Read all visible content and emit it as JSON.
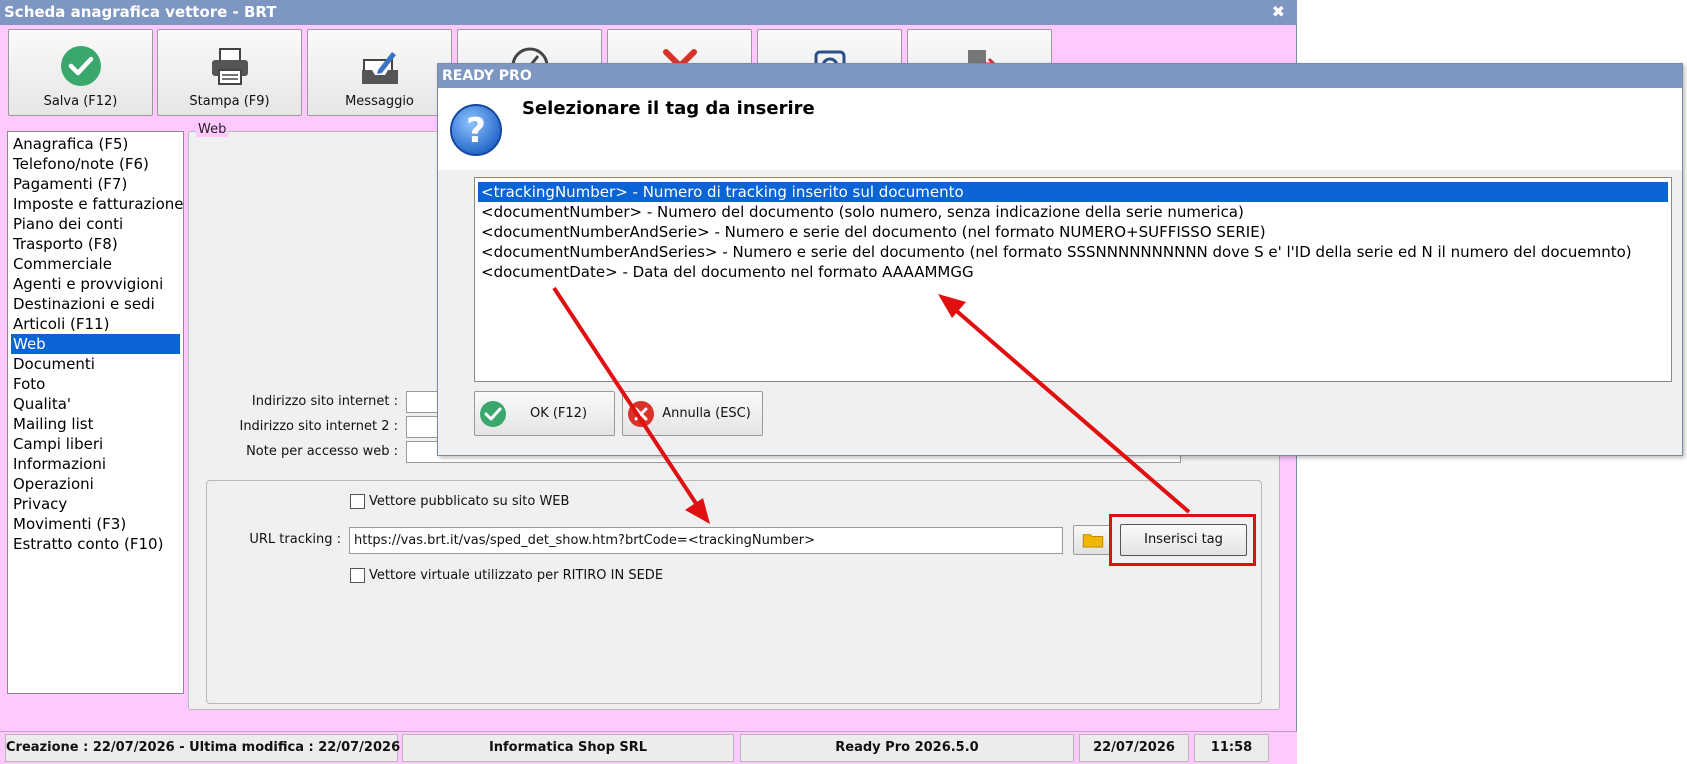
{
  "main_window": {
    "title": "Scheda anagrafica vettore - BRT",
    "close_glyph": "✖"
  },
  "toolbar": {
    "buttons": [
      {
        "label": "Salva (F12)",
        "icon": "check-circle-icon"
      },
      {
        "label": "Stampa (F9)",
        "icon": "printer-icon"
      },
      {
        "label": "Messaggio",
        "icon": "message-edit-icon"
      },
      {
        "label": "",
        "icon": "compass-icon"
      },
      {
        "label": "",
        "icon": "red-x-icon"
      },
      {
        "label": "",
        "icon": "camera-icon"
      },
      {
        "label": "",
        "icon": "exit-door-icon"
      }
    ]
  },
  "nav": {
    "items": [
      "Anagrafica (F5)",
      "Telefono/note (F6)",
      "Pagamenti (F7)",
      "Imposte e fatturazione",
      "Piano dei conti",
      "Trasporto (F8)",
      "Commerciale",
      "Agenti e provvigioni",
      "Destinazioni e sedi",
      "Articoli (F11)",
      "Web",
      "Documenti",
      "Foto",
      "Qualita'",
      "Mailing list",
      "Campi liberi",
      "Informazioni",
      "Operazioni",
      "Privacy",
      "Movimenti (F3)",
      "Estratto conto (F10)"
    ],
    "selected": "Web"
  },
  "web_panel": {
    "legend": "Web",
    "site_label": "Indirizzo sito internet :",
    "site2_label": "Indirizzo sito internet 2 :",
    "notes_label": "Note per accesso web :",
    "site_value": "",
    "site2_value": "",
    "notes_value": "",
    "published_label": "Vettore pubblicato su sito WEB",
    "url_label": "URL tracking :",
    "url_value": "https://vas.brt.it/vas/sped_det_show.htm?brtCode=<trackingNumber>",
    "virtual_label": "Vettore virtuale utilizzato per RITIRO IN SEDE",
    "insert_tag_label": "Inserisci tag"
  },
  "statusbar": {
    "dates": "Creazione : 22/07/2026 - Ultima modifica : 22/07/2026",
    "company": "Informatica Shop SRL",
    "version": "Ready Pro 2026.5.0",
    "date": "22/07/2026",
    "time": "11:58"
  },
  "dialog": {
    "title": "READY PRO",
    "heading": "Selezionare il tag da inserire",
    "tags": [
      "<trackingNumber> - Numero di tracking inserito sul documento",
      "<documentNumber> - Numero del documento (solo numero, senza indicazione della serie numerica)",
      "<documentNumberAndSerie> - Numero e serie del documento (nel formato NUMERO+SUFFISSO SERIE)",
      "<documentNumberAndSeries> - Numero e serie del documento (nel formato SSSNNNNNNNNNN dove S e' l'ID della serie ed N il numero del docuemnto)",
      "<documentDate> - Data del documento nel formato AAAAMMGG"
    ],
    "selected_index": 0,
    "ok_label": "OK (F12)",
    "cancel_label": "Annulla (ESC)"
  },
  "colors": {
    "titlebar": "#7e97c2",
    "window_bg": "#ffc8ff",
    "selection": "#0a64d6",
    "annotation_red": "#e01010",
    "ok_green": "#3aa76d",
    "cancel_red": "#d9322b"
  }
}
